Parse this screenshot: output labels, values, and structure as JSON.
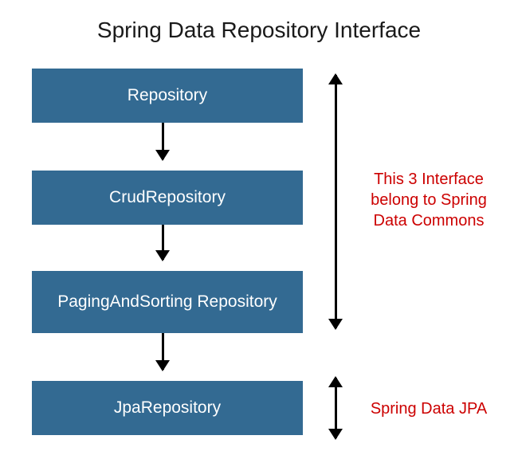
{
  "title": "Spring Data Repository Interface",
  "boxes": [
    {
      "label": "Repository"
    },
    {
      "label": "CrudRepository"
    },
    {
      "label": "PagingAndSorting Repository"
    },
    {
      "label": "JpaRepository"
    }
  ],
  "annotations": [
    {
      "text": "This 3 Interface belong to Spring Data Commons"
    },
    {
      "text": "Spring Data JPA"
    }
  ],
  "colors": {
    "box_bg": "#336a92",
    "box_text": "#ffffff",
    "annotation_text": "#cc0000",
    "arrow": "#000000"
  }
}
